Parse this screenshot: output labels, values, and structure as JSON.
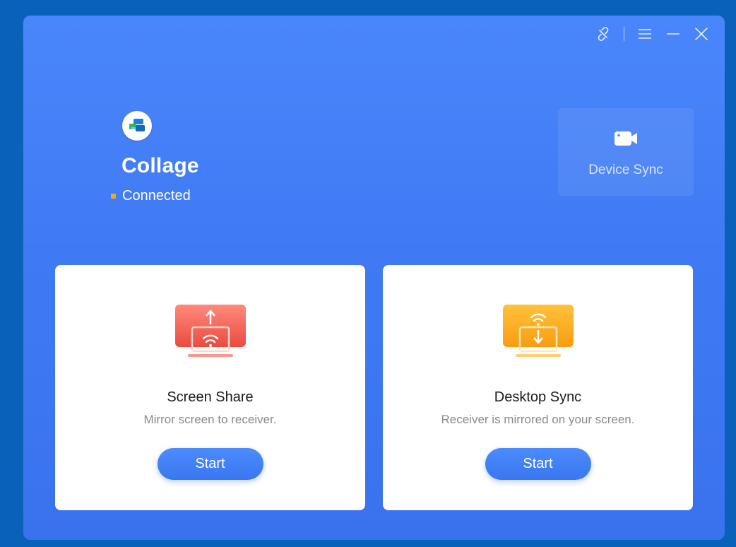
{
  "app": {
    "name": "Collage",
    "status": "Connected",
    "status_color": "#f5a623",
    "logo_icon": "collage-logo-icon"
  },
  "titlebar": {
    "icons": [
      "unlink-icon",
      "menu-icon",
      "minimize-icon",
      "close-icon"
    ]
  },
  "device_sync": {
    "label": "Device Sync",
    "icon": "camera-icon"
  },
  "cards": [
    {
      "title": "Screen Share",
      "description": "Mirror screen to receiver.",
      "button": "Start",
      "icon": "screen-share-icon",
      "accent": "#f0645a"
    },
    {
      "title": "Desktop Sync",
      "description": "Receiver is mirrored on your screen.",
      "button": "Start",
      "icon": "desktop-sync-icon",
      "accent": "#fbaa18"
    }
  ],
  "colors": {
    "background": "#0a62b8",
    "window": "#4080f6",
    "button": "#3f7ef4"
  }
}
